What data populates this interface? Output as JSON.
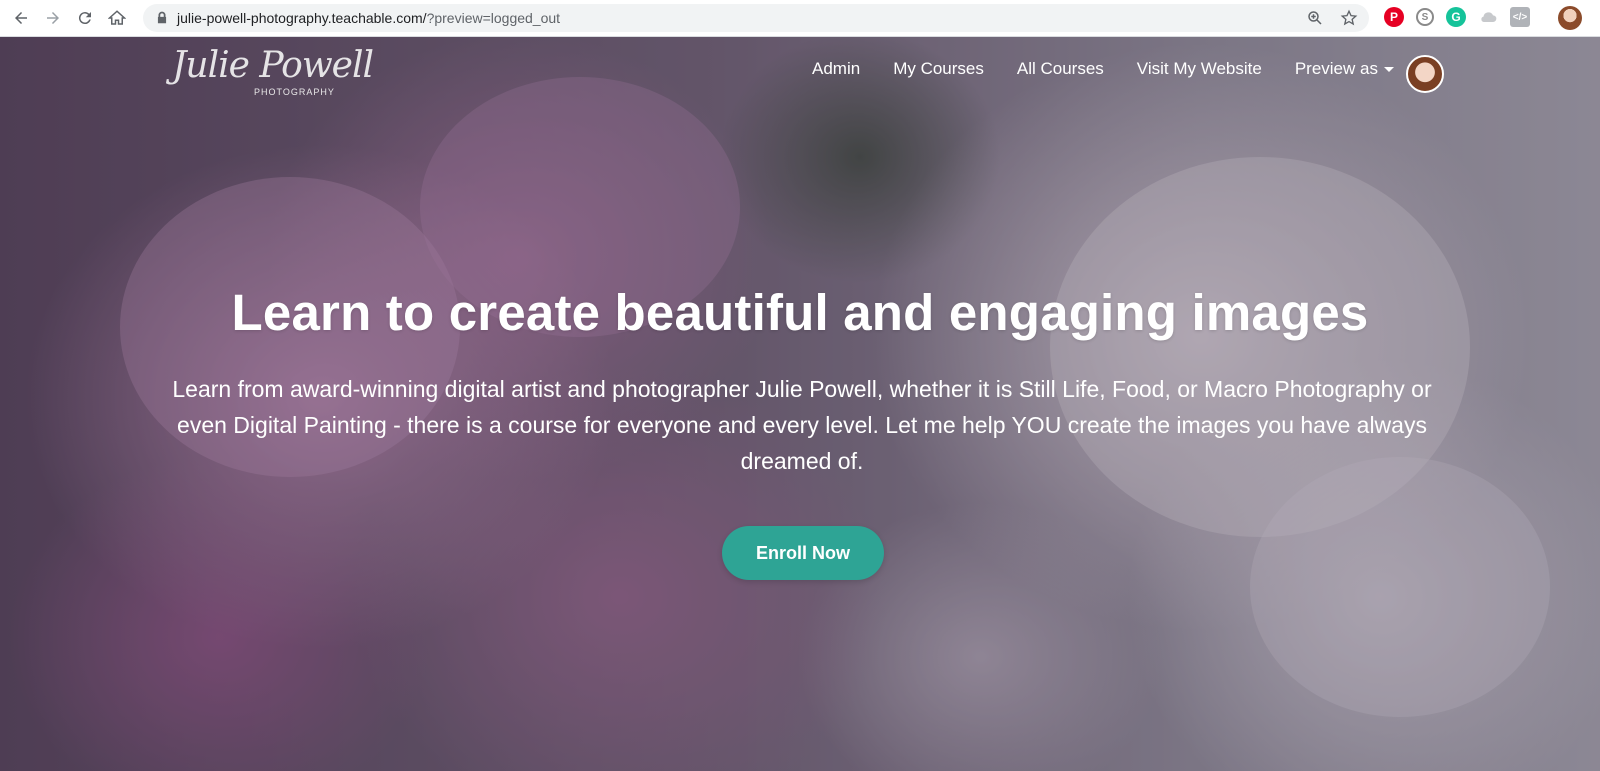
{
  "browser": {
    "url_host": "julie-powell-photography.teachable.com/",
    "url_path": "?preview=logged_out",
    "icons": [
      "back-icon",
      "forward-icon",
      "reload-icon",
      "home-icon",
      "lock-icon",
      "zoom-icon",
      "star-icon"
    ],
    "extensions": [
      "pinterest-icon",
      "skype-icon",
      "grammarly-icon",
      "cloud-icon",
      "code-icon"
    ]
  },
  "site": {
    "logo_script": "Julie Powell",
    "logo_sub": "PHOTOGRAPHY",
    "nav": {
      "admin": "Admin",
      "my_courses": "My Courses",
      "all_courses": "All Courses",
      "visit_website": "Visit My Website",
      "preview_as": "Preview as"
    }
  },
  "hero": {
    "headline": "Learn to create beautiful and engaging images",
    "subtext": "Learn from award-winning digital artist and photographer Julie Powell, whether it is Still Life, Food, or Macro Photography or even Digital Painting - there is a course for everyone and every level. Let me help YOU create the images you have always dreamed of.",
    "cta": "Enroll Now",
    "cta_color": "#2ea495"
  }
}
